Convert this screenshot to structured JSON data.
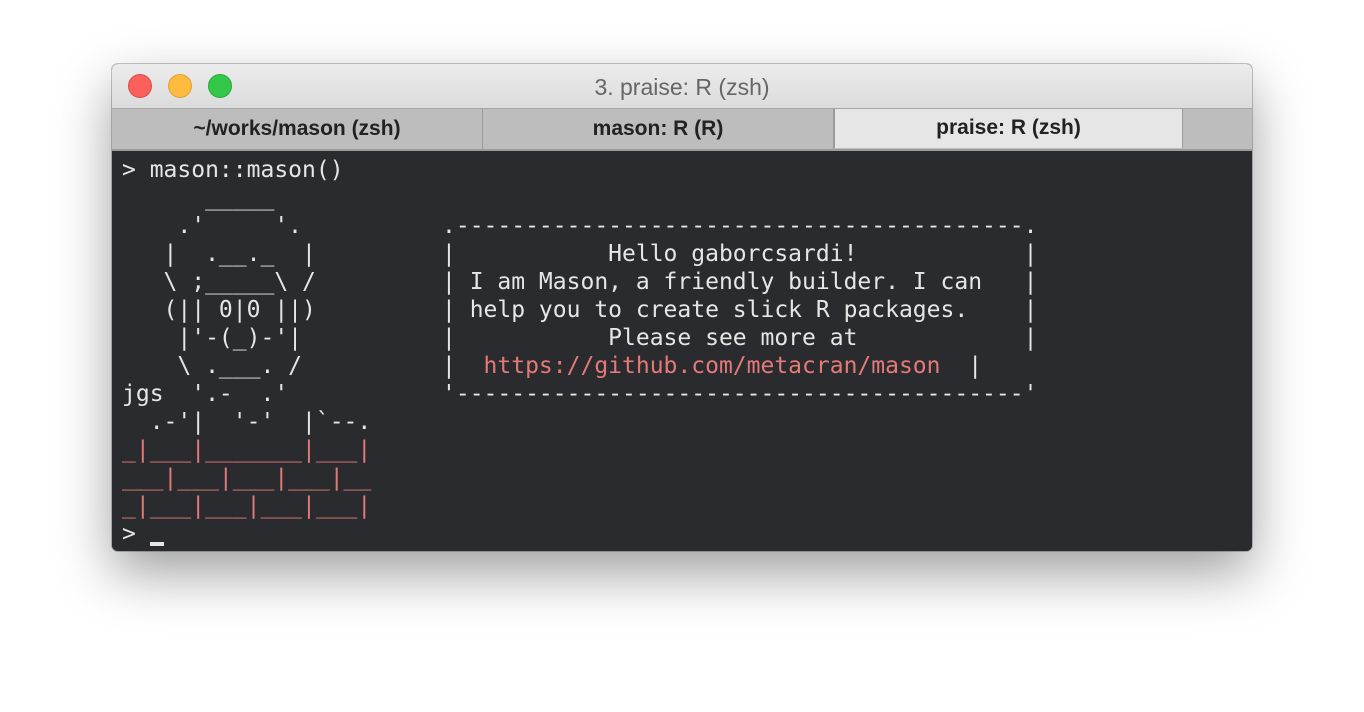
{
  "window": {
    "title": "3. praise: R (zsh)"
  },
  "tabs": [
    {
      "label": "~/works/mason (zsh)",
      "active": false
    },
    {
      "label": "mason: R (R)",
      "active": false
    },
    {
      "label": "praise: R (zsh)",
      "active": true
    }
  ],
  "terminal": {
    "command_line": "> mason::mason()",
    "art_lines": [
      "      _____",
      "    .'     '.",
      "   |  .__._  |",
      "   \\ ;_____\\ /",
      "   (|| 0|0 ||)",
      "    |'-(_)-'|",
      "    \\ .___. /",
      "jgs  '.-  .'",
      "  .-'|  '-'  |`--."
    ],
    "brick_lines": [
      "_|___|_______|___|",
      "___|___|___|___|__",
      "_|___|___|___|___|"
    ],
    "box": {
      "top": ".-----------------------------------------.",
      "greeting": "|           Hello gaborcsardi!            |",
      "line1": "| I am Mason, a friendly builder. I can   |",
      "line2": "| help you to create slick R packages.    |",
      "line3": "|           Please see more at            |",
      "link_prefix": "|  ",
      "link": "https://github.com/metacran/mason",
      "link_suffix": "  |",
      "bottom": "'-----------------------------------------'"
    },
    "prompt": "> "
  },
  "colors": {
    "terminal_bg": "#2a2b2e",
    "terminal_fg": "#e6e6e6",
    "accent_red": "#e47a78"
  }
}
